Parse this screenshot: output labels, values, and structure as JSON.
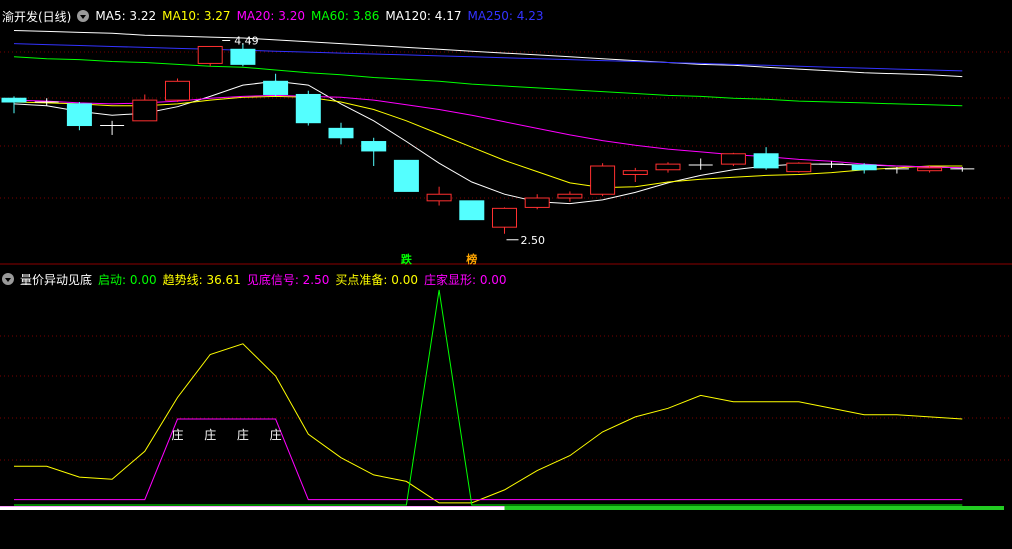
{
  "main_header": {
    "title": "渝开发(日线)",
    "items": [
      {
        "label": "MA5: 3.22",
        "color": "#ffffff"
      },
      {
        "label": "MA10: 3.27",
        "color": "#ffff00"
      },
      {
        "label": "MA20: 3.20",
        "color": "#ff00ff"
      },
      {
        "label": "MA60: 3.86",
        "color": "#00ff00"
      },
      {
        "label": "MA120: 4.17",
        "color": "#ffffff"
      },
      {
        "label": "MA250: 4.23",
        "color": "#3333ff"
      }
    ]
  },
  "sub_header": {
    "title": "量价异动见底",
    "items": [
      {
        "label": "启动: 0.00",
        "color": "#00ff00"
      },
      {
        "label": "趋势线: 36.61",
        "color": "#ffff00"
      },
      {
        "label": "见底信号: 2.50",
        "color": "#ff00ff"
      },
      {
        "label": "买点准备: 0.00",
        "color": "#ffff00"
      },
      {
        "label": "庄家显形: 0.00",
        "color": "#ff00ff"
      }
    ]
  },
  "chart_data": [
    {
      "type": "candlestick",
      "ylim": [
        2.2,
        4.75
      ],
      "high_annotation": "4.49",
      "low_annotation": "2.50",
      "markers": [
        {
          "index": 12,
          "text": "跌",
          "color": "#00ff00"
        },
        {
          "index": 14,
          "text": "榜",
          "color": "#ffa500"
        }
      ],
      "candles": [
        {
          "o": 3.94,
          "c": 3.9,
          "h": 3.96,
          "l": 3.78
        },
        {
          "o": 3.9,
          "c": 3.9,
          "h": 3.94,
          "l": 3.86
        },
        {
          "o": 3.88,
          "c": 3.65,
          "h": 3.9,
          "l": 3.6
        },
        {
          "o": 3.65,
          "c": 3.65,
          "h": 3.7,
          "l": 3.55
        },
        {
          "o": 3.7,
          "c": 3.92,
          "h": 3.98,
          "l": 3.7
        },
        {
          "o": 3.92,
          "c": 4.12,
          "h": 4.15,
          "l": 3.9
        },
        {
          "o": 4.31,
          "c": 4.49,
          "h": 4.49,
          "l": 4.28
        },
        {
          "o": 4.46,
          "c": 4.3,
          "h": 4.52,
          "l": 4.28
        },
        {
          "o": 4.12,
          "c": 3.98,
          "h": 4.2,
          "l": 3.96
        },
        {
          "o": 3.98,
          "c": 3.68,
          "h": 4.02,
          "l": 3.65
        },
        {
          "o": 3.62,
          "c": 3.52,
          "h": 3.68,
          "l": 3.45
        },
        {
          "o": 3.48,
          "c": 3.38,
          "h": 3.52,
          "l": 3.22
        },
        {
          "o": 3.28,
          "c": 2.95,
          "h": 3.28,
          "l": 2.95
        },
        {
          "o": 2.85,
          "c": 2.92,
          "h": 3.0,
          "l": 2.8
        },
        {
          "o": 2.85,
          "c": 2.65,
          "h": 2.85,
          "l": 2.65
        },
        {
          "o": 2.57,
          "c": 2.77,
          "h": 2.78,
          "l": 2.5
        },
        {
          "o": 2.78,
          "c": 2.88,
          "h": 2.92,
          "l": 2.76
        },
        {
          "o": 2.88,
          "c": 2.92,
          "h": 2.95,
          "l": 2.84
        },
        {
          "o": 2.92,
          "c": 3.22,
          "h": 3.25,
          "l": 2.9
        },
        {
          "o": 3.13,
          "c": 3.17,
          "h": 3.2,
          "l": 3.05
        },
        {
          "o": 3.18,
          "c": 3.24,
          "h": 3.26,
          "l": 3.15
        },
        {
          "o": 3.23,
          "c": 3.23,
          "h": 3.3,
          "l": 3.18
        },
        {
          "o": 3.24,
          "c": 3.35,
          "h": 3.36,
          "l": 3.22
        },
        {
          "o": 3.35,
          "c": 3.2,
          "h": 3.42,
          "l": 3.18
        },
        {
          "o": 3.16,
          "c": 3.25,
          "h": 3.26,
          "l": 3.15
        },
        {
          "o": 3.24,
          "c": 3.24,
          "h": 3.27,
          "l": 3.2
        },
        {
          "o": 3.23,
          "c": 3.18,
          "h": 3.25,
          "l": 3.14
        },
        {
          "o": 3.19,
          "c": 3.19,
          "h": 3.21,
          "l": 3.14
        },
        {
          "o": 3.17,
          "c": 3.2,
          "h": 3.22,
          "l": 3.15
        },
        {
          "o": 3.19,
          "c": 3.19,
          "h": 3.21,
          "l": 3.16
        }
      ],
      "series": [
        {
          "name": "MA5",
          "color": "#ffffff",
          "values": [
            3.88,
            3.86,
            3.8,
            3.76,
            3.78,
            3.85,
            3.96,
            4.08,
            4.12,
            4.08,
            3.88,
            3.7,
            3.48,
            3.25,
            3.05,
            2.92,
            2.84,
            2.82,
            2.86,
            2.94,
            3.04,
            3.12,
            3.18,
            3.22,
            3.24,
            3.24,
            3.23,
            3.22,
            3.21,
            3.2
          ]
        },
        {
          "name": "MA10",
          "color": "#ffff00",
          "values": [
            3.9,
            3.89,
            3.88,
            3.86,
            3.86,
            3.88,
            3.92,
            3.95,
            3.96,
            3.95,
            3.9,
            3.82,
            3.7,
            3.56,
            3.42,
            3.28,
            3.16,
            3.04,
            2.99,
            3.0,
            3.05,
            3.08,
            3.1,
            3.12,
            3.13,
            3.15,
            3.18,
            3.2,
            3.22,
            3.22
          ]
        },
        {
          "name": "MA20",
          "color": "#ff00ff",
          "values": [
            3.92,
            3.91,
            3.89,
            3.88,
            3.89,
            3.91,
            3.94,
            3.96,
            3.97,
            3.96,
            3.95,
            3.92,
            3.87,
            3.82,
            3.76,
            3.69,
            3.62,
            3.55,
            3.49,
            3.44,
            3.4,
            3.37,
            3.34,
            3.32,
            3.29,
            3.27,
            3.24,
            3.22,
            3.21,
            3.2
          ]
        },
        {
          "name": "MA60",
          "color": "#00ff00",
          "values": [
            4.38,
            4.36,
            4.35,
            4.33,
            4.32,
            4.3,
            4.28,
            4.27,
            4.24,
            4.21,
            4.19,
            4.16,
            4.14,
            4.12,
            4.09,
            4.07,
            4.05,
            4.03,
            4.01,
            3.99,
            3.97,
            3.96,
            3.94,
            3.93,
            3.91,
            3.9,
            3.89,
            3.88,
            3.87,
            3.86
          ]
        },
        {
          "name": "MA120",
          "color": "#ffffff",
          "values": [
            4.66,
            4.65,
            4.64,
            4.63,
            4.61,
            4.6,
            4.59,
            4.58,
            4.56,
            4.54,
            4.52,
            4.5,
            4.48,
            4.46,
            4.44,
            4.42,
            4.4,
            4.38,
            4.36,
            4.34,
            4.32,
            4.3,
            4.29,
            4.27,
            4.25,
            4.23,
            4.21,
            4.2,
            4.19,
            4.17
          ]
        },
        {
          "name": "MA250",
          "color": "#3333ff",
          "values": [
            4.52,
            4.51,
            4.5,
            4.49,
            4.48,
            4.47,
            4.46,
            4.45,
            4.44,
            4.43,
            4.42,
            4.41,
            4.4,
            4.39,
            4.38,
            4.37,
            4.36,
            4.35,
            4.34,
            4.33,
            4.32,
            4.31,
            4.3,
            4.29,
            4.28,
            4.27,
            4.26,
            4.25,
            4.24,
            4.23
          ]
        }
      ]
    },
    {
      "type": "line",
      "ylim": [
        0,
        100
      ],
      "series": [
        {
          "name": "趋势线",
          "color": "#ffff00",
          "values": [
            18,
            18,
            13,
            12,
            25,
            50,
            70,
            75,
            60,
            33,
            22,
            14,
            11,
            1,
            1,
            7,
            16,
            23,
            34,
            41,
            45,
            51,
            48,
            48,
            48,
            45,
            42,
            42,
            41,
            40
          ]
        },
        {
          "name": "见底信号",
          "color": "#ff00ff",
          "values": [
            2.5,
            2.5,
            2.5,
            2.5,
            2.5,
            40,
            40,
            40,
            40,
            2.5,
            2.5,
            2.5,
            2.5,
            2.5,
            2.5,
            2.5,
            2.5,
            2.5,
            2.5,
            2.5,
            2.5,
            2.5,
            2.5,
            2.5,
            2.5,
            2.5,
            2.5,
            2.5,
            2.5,
            2.5
          ]
        },
        {
          "name": "启动",
          "color": "#00ff00",
          "values": [
            0,
            0,
            0,
            0,
            0,
            0,
            0,
            0,
            0,
            0,
            0,
            0,
            0,
            100,
            0,
            0,
            0,
            0,
            0,
            0,
            0,
            0,
            0,
            0,
            0,
            0,
            0,
            0,
            0,
            0
          ]
        }
      ],
      "labels": [
        {
          "index": 5,
          "text": "庄"
        },
        {
          "index": 6,
          "text": "庄"
        },
        {
          "index": 7,
          "text": "庄"
        },
        {
          "index": 8,
          "text": "庄"
        }
      ],
      "bar_split_index": 15
    }
  ]
}
